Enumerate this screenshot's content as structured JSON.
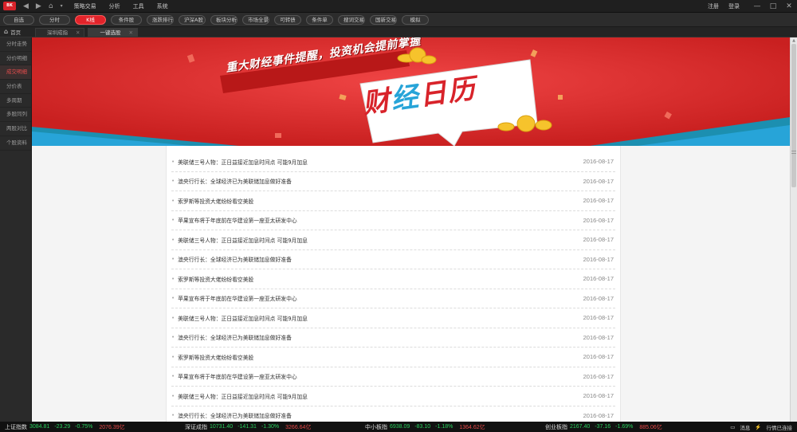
{
  "app": {
    "logo_text": "BK",
    "menu": [
      "策略交易",
      "分析",
      "工具",
      "系统"
    ],
    "right_links": [
      "注册",
      "登录"
    ],
    "window_controls": [
      "—",
      "□",
      "✕"
    ]
  },
  "navbar": {
    "pills": [
      "自选",
      "分时",
      "K线",
      "条件股",
      "涨跌排行",
      "沪深A股",
      "板块分析",
      "市场全景",
      "可转债",
      "条件单",
      "搜词交易",
      "国新交易",
      "模拟"
    ],
    "active_index": 2
  },
  "tabs": {
    "home": "首页",
    "items": [
      {
        "label": "深圳成指",
        "active": false
      },
      {
        "label": "一键选股",
        "active": true
      }
    ]
  },
  "sidebar": {
    "items": [
      "分时走势",
      "分价明细",
      "成交明细",
      "分价表",
      "多周期",
      "多股同列",
      "两股对比",
      "个股资料"
    ],
    "active_index": 2
  },
  "banner": {
    "headline": "重大财经事件提醒，投资机会提前掌握",
    "title_part1": "财",
    "title_part2": "经",
    "title_part3": "日历",
    "colors": {
      "red": "#e03232",
      "blue": "#27a4d8",
      "gold": "#f6c32c"
    }
  },
  "news": [
    {
      "title": "美联储三号人物：正日益接近加息时间点 可能9月加息",
      "date": "2016-08-17"
    },
    {
      "title": "澳央行行长：全球经济已为美联储加息做好准备",
      "date": "2016-08-17"
    },
    {
      "title": "索罗斯等投资大佬纷纷看空美股",
      "date": "2016-08-17"
    },
    {
      "title": "苹果宣布将于年底前在华建设第一座亚太研发中心",
      "date": "2016-08-17"
    },
    {
      "title": "美联储三号人物：正日益接近加息时间点 可能9月加息",
      "date": "2016-08-17"
    },
    {
      "title": "澳央行行长：全球经济已为美联储加息做好准备",
      "date": "2016-08-17"
    },
    {
      "title": "索罗斯等投资大佬纷纷看空美股",
      "date": "2016-08-17"
    },
    {
      "title": "苹果宣布将于年底前在华建设第一座亚太研发中心",
      "date": "2016-08-17"
    },
    {
      "title": "美联储三号人物：正日益接近加息时间点 可能9月加息",
      "date": "2016-08-17"
    },
    {
      "title": "澳央行行长：全球经济已为美联储加息做好准备",
      "date": "2016-08-17"
    },
    {
      "title": "索罗斯等投资大佬纷纷看空美股",
      "date": "2016-08-17"
    },
    {
      "title": "苹果宣布将于年底前在华建设第一座亚太研发中心",
      "date": "2016-08-17"
    },
    {
      "title": "美联储三号人物：正日益接近加息时间点 可能9月加息",
      "date": "2016-08-17"
    },
    {
      "title": "澳央行行长：全球经济已为美联储加息做好准备",
      "date": "2016-08-17"
    }
  ],
  "statusbar": {
    "indices": [
      {
        "name": "上证指数",
        "value": "3084.81",
        "change": "-23.29",
        "pct": "-0.75%",
        "amount": "2076.39亿"
      },
      {
        "name": "深证成指",
        "value": "10731.40",
        "change": "-141.31",
        "pct": "-1.30%",
        "amount": "3266.64亿"
      },
      {
        "name": "中小板指",
        "value": "6938.09",
        "change": "-83.10",
        "pct": "-1.18%",
        "amount": "1364.62亿"
      },
      {
        "name": "创业板指",
        "value": "2167.40",
        "change": "-37.16",
        "pct": "-1.69%",
        "amount": "885.06亿"
      }
    ],
    "message_label": "消息",
    "connection_label": "行情已连接"
  }
}
